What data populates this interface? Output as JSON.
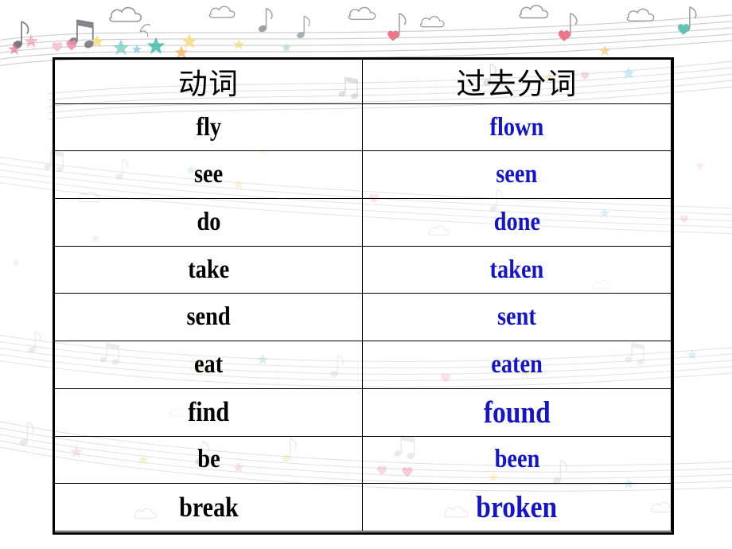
{
  "slide": {
    "background_theme": "pastel music staff with notes, stars, hearts and clouds",
    "accent_color": "#1414C8",
    "text_color": "#000000",
    "border_color": "#000000"
  },
  "table": {
    "headers": [
      "动词",
      "过去分词"
    ],
    "rows": [
      {
        "verb": "fly",
        "participle": "flown",
        "emphasis": false
      },
      {
        "verb": "see",
        "participle": "seen",
        "emphasis": false
      },
      {
        "verb": "do",
        "participle": "done",
        "emphasis": false
      },
      {
        "verb": "take",
        "participle": "taken",
        "emphasis": false
      },
      {
        "verb": "send",
        "participle": "sent",
        "emphasis": false
      },
      {
        "verb": "eat",
        "participle": "eaten",
        "emphasis": false
      },
      {
        "verb": "find",
        "participle": "found",
        "emphasis": true
      },
      {
        "verb": "be",
        "participle": "been",
        "emphasis": false
      },
      {
        "verb": "break",
        "participle": "broken",
        "emphasis": true
      }
    ]
  }
}
